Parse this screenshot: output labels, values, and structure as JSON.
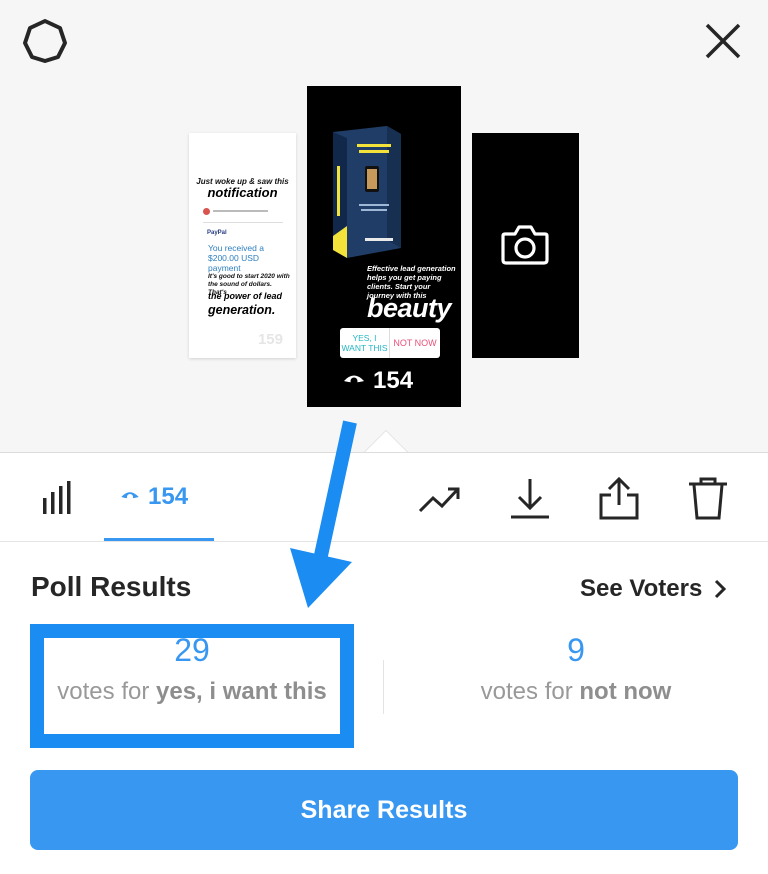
{
  "header": {
    "settings_icon": "gear-icon",
    "close_icon": "close-icon"
  },
  "stories": {
    "left": {
      "line1": "Just woke up & saw this",
      "line2": "notification",
      "brand": "PayPal",
      "received": "You received a $200.00 USD payment",
      "good": "It's good to start 2020 with the sound of dollars. That's",
      "power": "the power of lead",
      "generation": "generation.",
      "view_count": "159"
    },
    "center": {
      "caption": "Effective lead generation helps you get paying clients. Start your journey with this",
      "headline": "beauty",
      "poll_yes": "YES, I WANT THIS",
      "poll_no": "NOT NOW",
      "view_count": "154"
    },
    "right": {
      "icon": "camera-icon"
    }
  },
  "toolbar": {
    "views_count": "154",
    "icons": [
      "bar-chart-icon",
      "eye-icon",
      "trending-icon",
      "download-icon",
      "share-icon",
      "trash-icon"
    ]
  },
  "poll_results": {
    "title": "Poll Results",
    "see_voters": "See Voters",
    "options": [
      {
        "count": "29",
        "label_prefix": "votes for",
        "label_option": "yes, i want this"
      },
      {
        "count": "9",
        "label_prefix": "votes for",
        "label_option": "not now"
      }
    ]
  },
  "share_button": "Share Results",
  "colors": {
    "accent": "#3897f0",
    "annotation": "#1a8cf2"
  }
}
